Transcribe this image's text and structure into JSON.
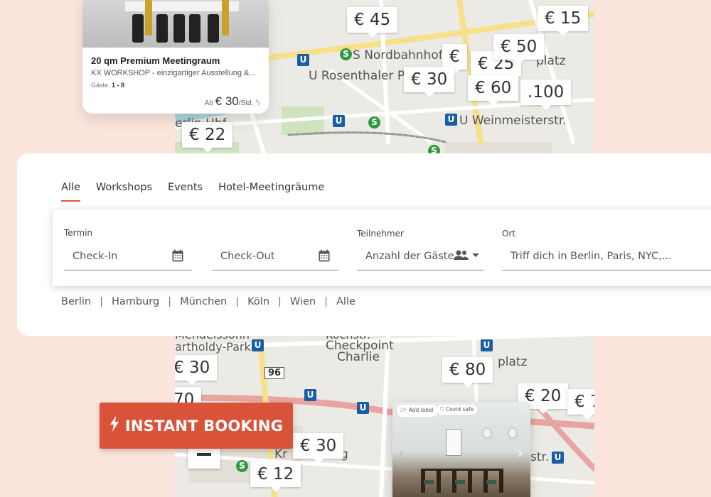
{
  "map": {
    "labels": {
      "nordbahnhof": "S Nordbahnhof",
      "rosenthaler": "U Rosenthaler P",
      "weinmeister": "U Weinmeisterstr.",
      "hbf": "erlin Hbf",
      "platz_top": "platz",
      "mendelssohn": "Mendelssohn",
      "bartholdy": "artholdy-Park",
      "checkpoint_1": "Checkpoint",
      "checkpoint_2": "Charlie",
      "kochstr": "Kochstr.",
      "platz_bottom": "platz",
      "str": "str.",
      "kr": "Kr",
      "g": "g",
      "road_96": "96"
    },
    "pins": {
      "p45": "€ 45",
      "p15": "€ 15",
      "p50": "€ 50",
      "p25": "€ 25",
      "pE": "€",
      "p30a": "€ 30",
      "p60": "€ 60",
      "p100": ".100",
      "p22": "€ 22",
      "p30b": "€ 30",
      "p70": "70",
      "p80": "€ 80",
      "p20": "€ 20",
      "p7": "€ 7",
      "p30c": "€ 30",
      "p12": "€ 12"
    },
    "station_letters": {
      "u": "U",
      "s": "S"
    }
  },
  "top_card": {
    "title": "20 qm Premium Meetingraum",
    "description": "KX WORKSHOP - einzigartiger Ausstellung &...",
    "guests_label": "Gäste:",
    "guests_value": "1 - 8",
    "price_prefix": "Ab",
    "price_amount": "€ 30",
    "price_unit": "/Std."
  },
  "search": {
    "tabs": [
      "Alle",
      "Workshops",
      "Events",
      "Hotel-Meetingräume"
    ],
    "active_tab": "Alle",
    "termin_label": "Termin",
    "checkin_placeholder": "Check-In",
    "checkout_placeholder": "Check-Out",
    "teilnehmer_label": "Teilnehmer",
    "guests_placeholder": "Anzahl der Gäste",
    "ort_label": "Ort",
    "location_placeholder": "Triff dich in Berlin, Paris, NYC,...",
    "cities": [
      "Berlin",
      "Hamburg",
      "München",
      "Köln",
      "Wien",
      "Alle"
    ],
    "separator": "|"
  },
  "instant_booking": {
    "label": "INSTANT BOOKING"
  },
  "bottom_card": {
    "add_label": "Add label",
    "covid_label": "Covid safe"
  },
  "colors": {
    "accent": "#d9533a",
    "background": "#fbe5dd",
    "ubahn": "#1a5da6",
    "sbahn": "#2e9b3e"
  }
}
